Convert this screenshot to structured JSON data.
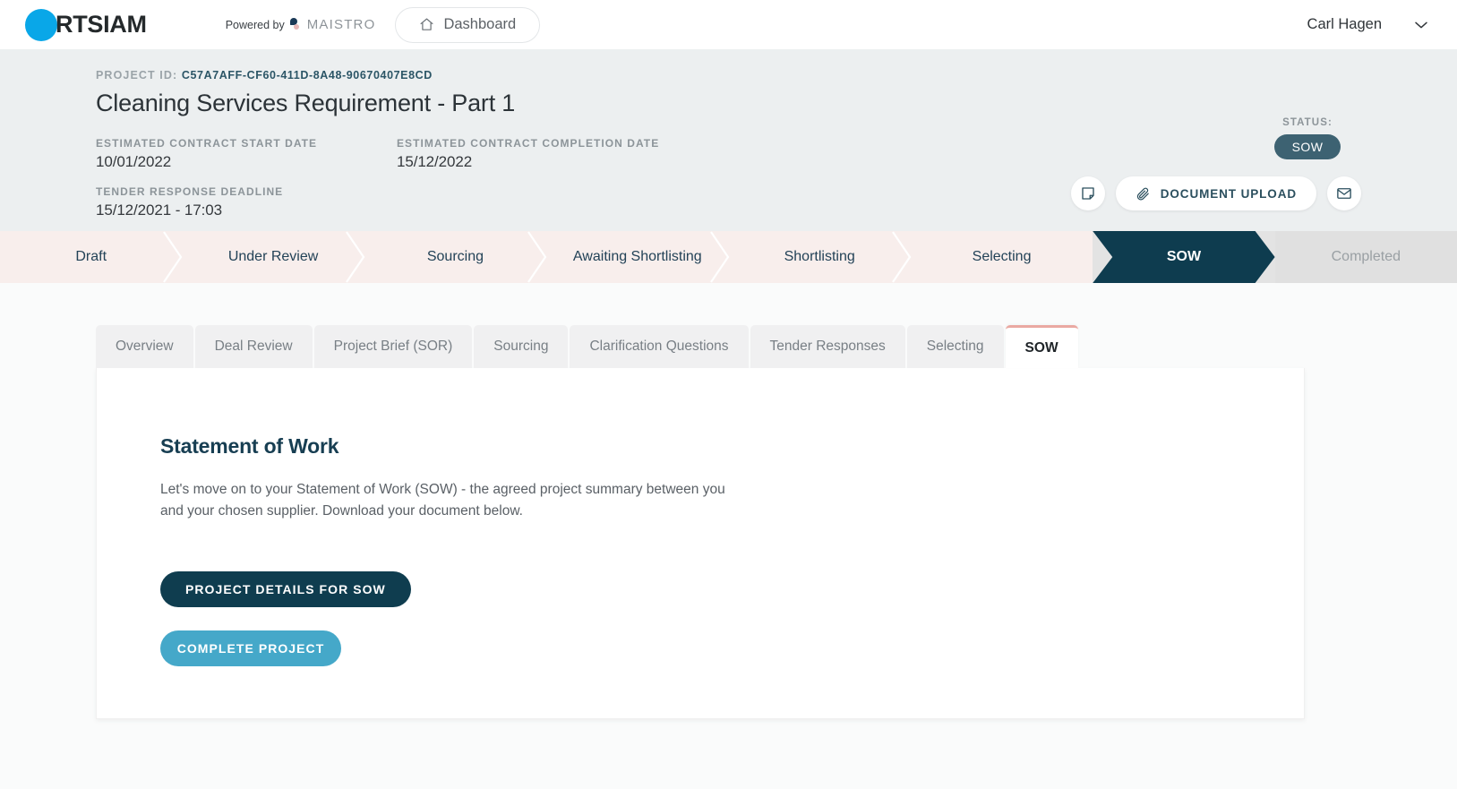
{
  "topnav": {
    "logo_text": "RTSIAM",
    "powered_by": "Powered by",
    "maistro": "MAISTRO",
    "dashboard_label": "Dashboard",
    "user_name": "Carl Hagen"
  },
  "project": {
    "id_label": "PROJECT ID:",
    "id_value": "C57A7AFF-CF60-411D-8A48-90670407E8CD",
    "title": "Cleaning Services Requirement - Part 1",
    "start_label": "ESTIMATED CONTRACT START DATE",
    "start_value": "10/01/2022",
    "completion_label": "ESTIMATED CONTRACT COMPLETION DATE",
    "completion_value": "15/12/2022",
    "deadline_label": "TENDER RESPONSE DEADLINE",
    "deadline_value": "15/12/2021 - 17:03",
    "status_label": "STATUS:",
    "status_value": "SOW",
    "upload_label": "DOCUMENT UPLOAD"
  },
  "stepper": {
    "steps": [
      {
        "label": "Draft",
        "state": "pending"
      },
      {
        "label": "Under Review",
        "state": "pending"
      },
      {
        "label": "Sourcing",
        "state": "pending"
      },
      {
        "label": "Awaiting Shortlisting",
        "state": "pending"
      },
      {
        "label": "Shortlisting",
        "state": "pending"
      },
      {
        "label": "Selecting",
        "state": "pending"
      },
      {
        "label": "SOW",
        "state": "active"
      },
      {
        "label": "Completed",
        "state": "done"
      }
    ]
  },
  "tabs": [
    {
      "label": "Overview",
      "active": false
    },
    {
      "label": "Deal Review",
      "active": false
    },
    {
      "label": "Project Brief (SOR)",
      "active": false
    },
    {
      "label": "Sourcing",
      "active": false
    },
    {
      "label": "Clarification Questions",
      "active": false
    },
    {
      "label": "Tender Responses",
      "active": false
    },
    {
      "label": "Selecting",
      "active": false
    },
    {
      "label": "SOW",
      "active": true
    }
  ],
  "sow": {
    "heading": "Statement of Work",
    "description": "Let's move on to your Statement of Work (SOW) - the agreed project summary between you and your chosen supplier. Download your document below.",
    "primary_button": "PROJECT DETAILS FOR SOW",
    "secondary_button": "COMPLETE PROJECT"
  },
  "colors": {
    "logo_blue": "#09a7e8",
    "status_pill": "#3d6272",
    "step_active": "#0e3c4f",
    "step_pending": "#f8eeec",
    "step_done": "#e0e0e0",
    "tab_active_accent": "#eaa9a2",
    "primary_button": "#0f3d4f",
    "secondary_button": "#45a8c9",
    "heading": "#173e52"
  }
}
